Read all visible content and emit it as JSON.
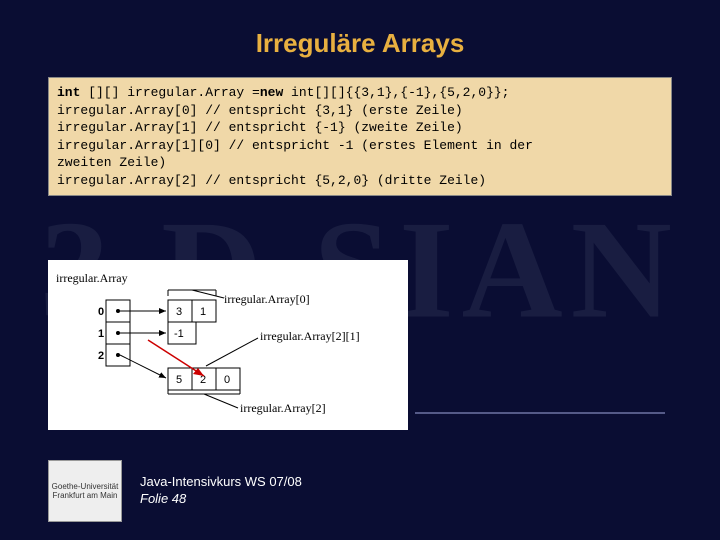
{
  "title": "Irreguläre Arrays",
  "watermark": "3 D  SIAN",
  "code": {
    "l1a": "int",
    "l1b": " [][] irregular.Array =",
    "l1c": "new",
    "l1d": " int[][]{{3,1},{-1},{5,2,0}};",
    "l2": "   irregular.Array[0] // entspricht {3,1} (erste Zeile)",
    "l3": "irregular.Array[1] // entspricht {-1} (zweite Zeile)",
    "l4": "irregular.Array[1][0] // entspricht -1 (erstes Element in der",
    "l5": "  zweiten Zeile)",
    "l6": "irregular.Array[2] // entspricht {5,2,0} (dritte Zeile)"
  },
  "diagram": {
    "mainLabel": "irregular.Array",
    "idx": [
      "0",
      "1",
      "2"
    ],
    "row0": [
      "3",
      "1"
    ],
    "row1": [
      "-1"
    ],
    "row2": [
      "5",
      "2",
      "0"
    ],
    "lab0": "irregular.Array[0]",
    "lab21": "irregular.Array[2][1]",
    "lab2": "irregular.Array[2]"
  },
  "footer": {
    "line1": "Java-Intensivkurs WS 07/08",
    "line2": "Folie 48",
    "logoAlt": "Goethe-Universität Frankfurt am Main"
  }
}
